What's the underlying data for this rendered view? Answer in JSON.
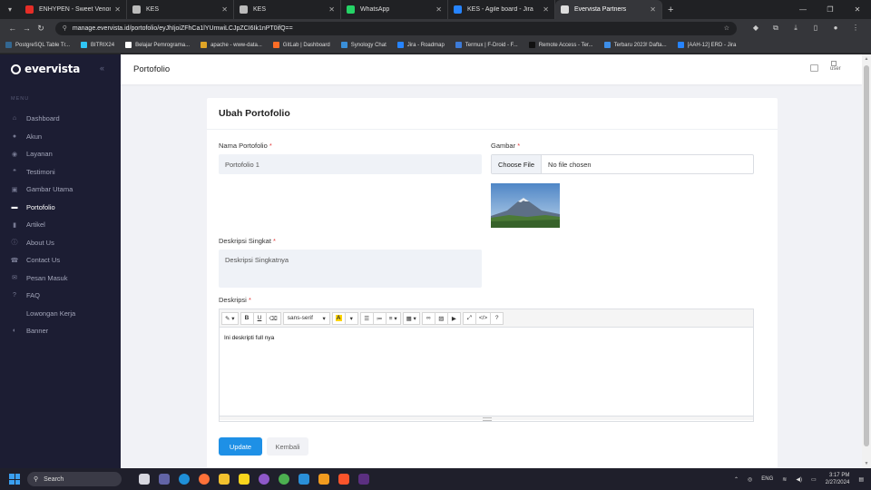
{
  "browser": {
    "tabs": [
      {
        "title": "ENHYPEN - Sweet Venom | Perf",
        "color": "#e52d27"
      },
      {
        "title": "KES",
        "color": "#bbbbbb"
      },
      {
        "title": "KES",
        "color": "#bbbbbb"
      },
      {
        "title": "WhatsApp",
        "color": "#25d366"
      },
      {
        "title": "KES - Agile board - Jira",
        "color": "#2684ff"
      },
      {
        "title": "Evervista Partners",
        "color": "#dddddd"
      }
    ],
    "new_tab": "+",
    "url": "manage.evervista.id/portofolio/eyJhIjoiZFhCa1lYUmwiLCJpZCI6Ik1nPT0ifQ==",
    "bookmarks": [
      {
        "label": "PostgreSQL Table Tr...",
        "color": "#336791"
      },
      {
        "label": "BITRIX24",
        "color": "#2fc6f6"
      },
      {
        "label": "Belajar Pemrograma...",
        "color": "#ffffff"
      },
      {
        "label": "apache - www-data...",
        "color": "#e0a526"
      },
      {
        "label": "GitLab | Dashboard",
        "color": "#fc6d26"
      },
      {
        "label": "Synology Chat",
        "color": "#3a8fd8"
      },
      {
        "label": "Jira - Roadmap",
        "color": "#2684ff"
      },
      {
        "label": "Termux | F-Droid - F...",
        "color": "#3d7bd8"
      },
      {
        "label": "Remote Access - Ter...",
        "color": "#111111"
      },
      {
        "label": "Terbaru 2023! Dafta...",
        "color": "#3d8ee8"
      },
      {
        "label": "[AAH-12] ERD - Jira",
        "color": "#2684ff"
      }
    ]
  },
  "app": {
    "brand": "evervista",
    "menu_heading": "MENU",
    "menu": [
      {
        "label": "Dashboard",
        "icon": "⌂",
        "active": false
      },
      {
        "label": "Akun",
        "icon": "●",
        "active": false
      },
      {
        "label": "Layanan",
        "icon": "◉",
        "active": false
      },
      {
        "label": "Testimoni",
        "icon": "❝",
        "active": false
      },
      {
        "label": "Gambar Utama",
        "icon": "▣",
        "active": false
      },
      {
        "label": "Portofolio",
        "icon": "▬",
        "active": true
      },
      {
        "label": "Artikel",
        "icon": "▮",
        "active": false
      },
      {
        "label": "About Us",
        "icon": "ⓘ",
        "active": false
      },
      {
        "label": "Contact Us",
        "icon": "☎",
        "active": false
      },
      {
        "label": "Pesan Masuk",
        "icon": "✉",
        "active": false
      },
      {
        "label": "FAQ",
        "icon": "?",
        "active": false
      },
      {
        "label": "Lowongan Kerja",
        "icon": "",
        "active": false
      },
      {
        "label": "Banner",
        "icon": "◐",
        "active": false
      }
    ],
    "page_title": "Portofolio",
    "user_label": "user",
    "accent": "#1e90e6",
    "sidebar_bg": "#1c1d33"
  },
  "form": {
    "title": "Ubah Portofolio",
    "required_mark": "*",
    "name_label": "Nama Portofolio",
    "name_value": "Portofolio 1",
    "image_label": "Gambar",
    "choose_file": "Choose File",
    "no_file": "No file chosen",
    "short_desc_label": "Deskripsi Singkat",
    "short_desc_value": "Deskripsi Singkatnya",
    "desc_label": "Deskripsi",
    "desc_content": "Ini deskripti full nya",
    "font_select": "sans-serif",
    "update_button": "Update",
    "back_button": "Kembali"
  },
  "taskbar": {
    "search_placeholder": "Search",
    "language": "ENG",
    "time": "3:17 PM",
    "date": "2/27/2024"
  }
}
